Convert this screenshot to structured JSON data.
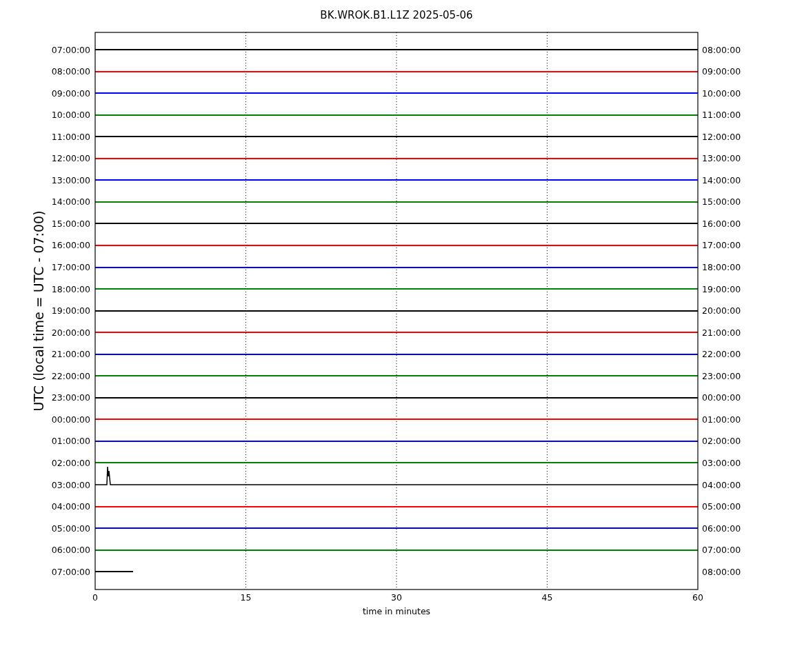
{
  "title": "BK.WROK.B1.L1Z 2025-05-06",
  "ylabel": "UTC (local time = UTC - 07:00)",
  "xlabel": "time in minutes",
  "xticks": [
    "0",
    "15",
    "30",
    "45",
    "60"
  ],
  "rows": [
    {
      "left": "07:00:00",
      "right": "08:00:00",
      "color": "#000000",
      "kind": "flat",
      "level": 1
    },
    {
      "left": "08:00:00",
      "right": "09:00:00",
      "color": "#ff0000",
      "kind": "flat",
      "level": 1
    },
    {
      "left": "09:00:00",
      "right": "10:00:00",
      "color": "#0000ff",
      "kind": "flat",
      "level": 1
    },
    {
      "left": "10:00:00",
      "right": "11:00:00",
      "color": "#008000",
      "kind": "flat",
      "level": 1
    },
    {
      "left": "11:00:00",
      "right": "12:00:00",
      "color": "#000000",
      "kind": "flat",
      "level": 1
    },
    {
      "left": "12:00:00",
      "right": "13:00:00",
      "color": "#ff0000",
      "kind": "flat",
      "level": 1
    },
    {
      "left": "13:00:00",
      "right": "14:00:00",
      "color": "#0000ff",
      "kind": "flat",
      "level": 1
    },
    {
      "left": "14:00:00",
      "right": "15:00:00",
      "color": "#008000",
      "kind": "flat",
      "level": 1
    },
    {
      "left": "15:00:00",
      "right": "16:00:00",
      "color": "#000000",
      "kind": "flat",
      "level": 1
    },
    {
      "left": "16:00:00",
      "right": "17:00:00",
      "color": "#ff0000",
      "kind": "flat",
      "level": 1
    },
    {
      "left": "17:00:00",
      "right": "18:00:00",
      "color": "#0000ff",
      "kind": "flat",
      "level": 1
    },
    {
      "left": "18:00:00",
      "right": "19:00:00",
      "color": "#008000",
      "kind": "flat",
      "level": 1
    },
    {
      "left": "19:00:00",
      "right": "20:00:00",
      "color": "#000000",
      "kind": "flat",
      "level": 1
    },
    {
      "left": "20:00:00",
      "right": "21:00:00",
      "color": "#ff0000",
      "kind": "flat",
      "level": 1
    },
    {
      "left": "21:00:00",
      "right": "22:00:00",
      "color": "#0000ff",
      "kind": "flat",
      "level": 1
    },
    {
      "left": "22:00:00",
      "right": "23:00:00",
      "color": "#008000",
      "kind": "flat",
      "level": 1
    },
    {
      "left": "23:00:00",
      "right": "00:00:00",
      "color": "#000000",
      "kind": "flat",
      "level": 1
    },
    {
      "left": "00:00:00",
      "right": "01:00:00",
      "color": "#ff0000",
      "kind": "flat",
      "level": 1
    },
    {
      "left": "01:00:00",
      "right": "02:00:00",
      "color": "#0000ff",
      "kind": "flat",
      "level": 1
    },
    {
      "left": "02:00:00",
      "right": "03:00:00",
      "color": "#008000",
      "kind": "flat",
      "level": 1
    },
    {
      "left": "03:00:00",
      "right": "04:00:00",
      "color": "#000000",
      "kind": "spike",
      "level": 1
    },
    {
      "left": "04:00:00",
      "right": "05:00:00",
      "color": "#ff0000",
      "kind": "flat",
      "level": 1
    },
    {
      "left": "05:00:00",
      "right": "06:00:00",
      "color": "#0000ff",
      "kind": "flat",
      "level": 1
    },
    {
      "left": "06:00:00",
      "right": "07:00:00",
      "color": "#008000",
      "kind": "flat",
      "level": 1
    },
    {
      "left": "07:00:00",
      "right": "08:00:00",
      "color": "#000000",
      "kind": "flat",
      "level": 0.063
    }
  ]
}
